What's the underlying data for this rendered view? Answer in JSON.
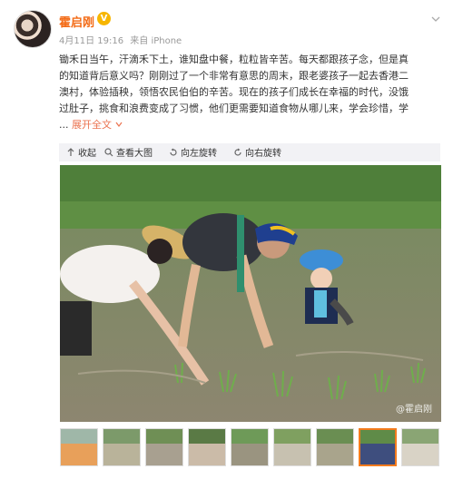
{
  "user": {
    "name": "霍启刚",
    "verified_badge": "V",
    "date": "4月11日 19:16",
    "source": "来自 iPhone"
  },
  "post": {
    "lines": [
      "锄禾日当午，汗滴禾下土，谁知盘中餐，粒粒皆辛苦。每天都跟孩子念，但是真",
      "的知道背后意义吗？刚刚过了一个非常有意思的周末，跟老婆孩子一起去香港二",
      "澳村，体验插秧，领悟农民伯伯的辛苦。现在的孩子们成长在幸福的时代，没饿",
      "过肚子，挑食和浪费变成了习惯，他们更需要知道食物从哪儿来，学会珍惜，学"
    ],
    "ellipsis": "...",
    "expand_label": "展开全文",
    "expand_icon": "chevron-down-icon"
  },
  "actions": {
    "collapse": "收起",
    "view_large": "查看大图",
    "rotate_left": "向左旋转",
    "rotate_right": "向右旋转"
  },
  "photo": {
    "watermark": "@霍启刚"
  },
  "thumbnails": {
    "count": 9,
    "active_index": 7
  },
  "colors": {
    "username": "#f36b16",
    "link": "#eb7350",
    "active_thumb_border": "#f37b1d",
    "verified": "#f7b600"
  }
}
